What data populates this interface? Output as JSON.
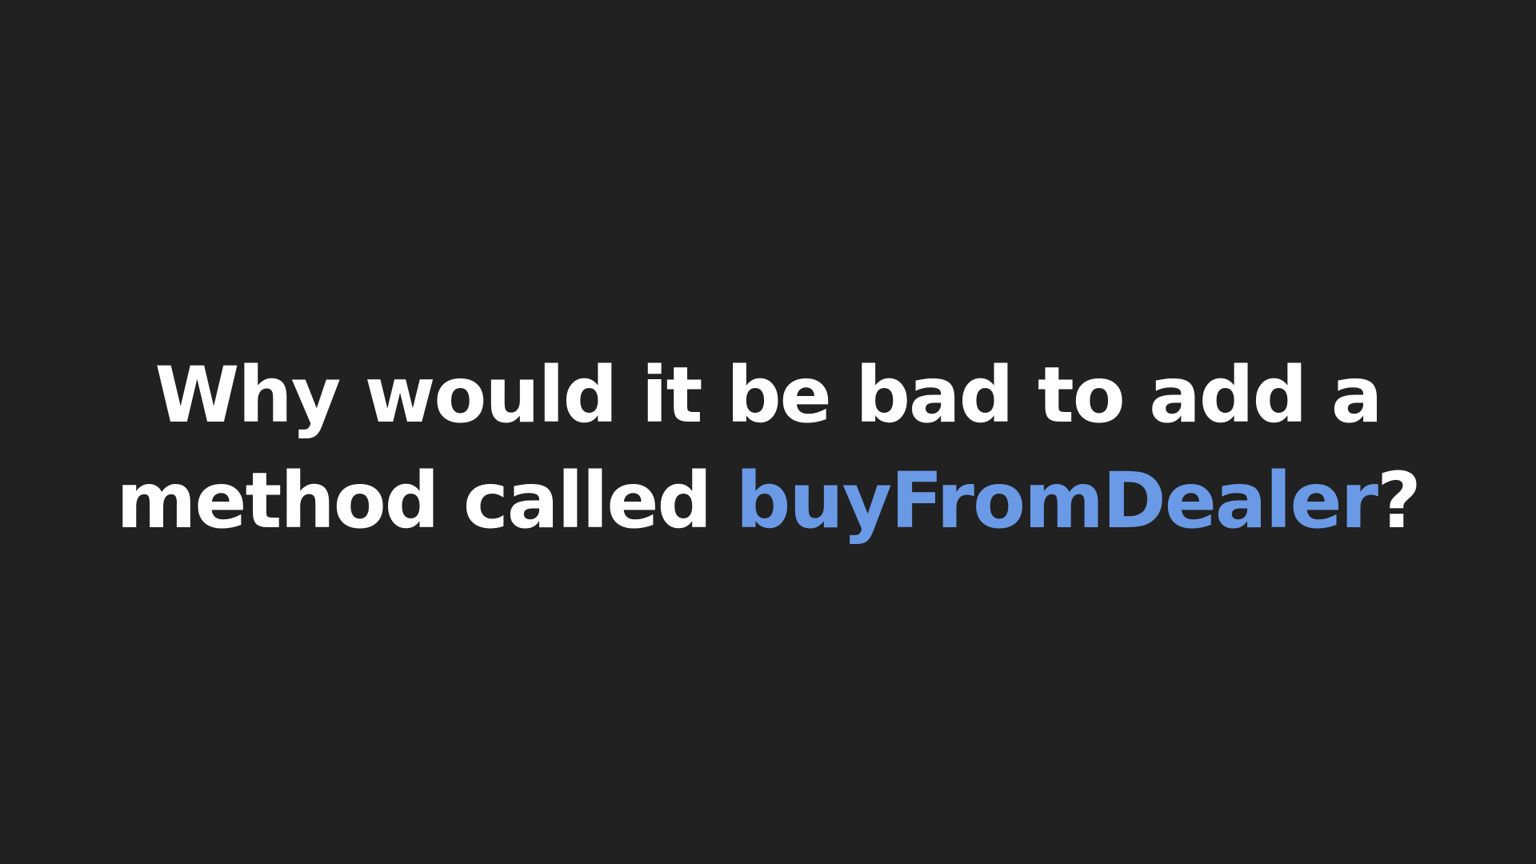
{
  "slide": {
    "line1": "Why would it be bad to add a",
    "line2_prefix": "method called ",
    "highlight": "buyFromDealer",
    "line2_suffix": "?"
  },
  "colors": {
    "background": "#212121",
    "text": "#ffffff",
    "highlight": "#6a9ae6"
  }
}
